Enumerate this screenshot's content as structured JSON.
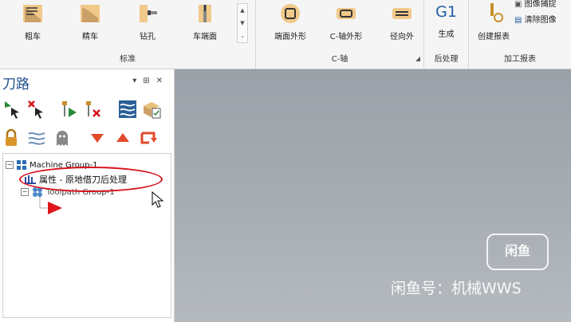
{
  "ribbon": {
    "groups": [
      {
        "label": "标准",
        "buttons": [
          "粗车",
          "精车",
          "钻孔",
          "车端面"
        ]
      },
      {
        "label": "C-轴",
        "buttons": [
          "端面外形",
          "C-轴外形",
          "径向外"
        ]
      },
      {
        "label": "后处理",
        "buttons": [
          "生成"
        ],
        "g1": "G1"
      },
      {
        "label": "加工报表",
        "buttons": [
          "创建报表"
        ],
        "small": [
          "图像捕捉",
          "清除图像"
        ]
      }
    ]
  },
  "panel": {
    "title": "刀路",
    "tree": {
      "machine_group": "Machine Group-1",
      "properties": "属性 - 原地借刀后处理",
      "toolpath_group": "Toolpath Group-1"
    }
  },
  "watermark": {
    "logo": "闲鱼",
    "text": "闲鱼号：机械WWS"
  },
  "colors": {
    "accent_red": "#d8121c",
    "title_blue": "#1f4e8c"
  }
}
